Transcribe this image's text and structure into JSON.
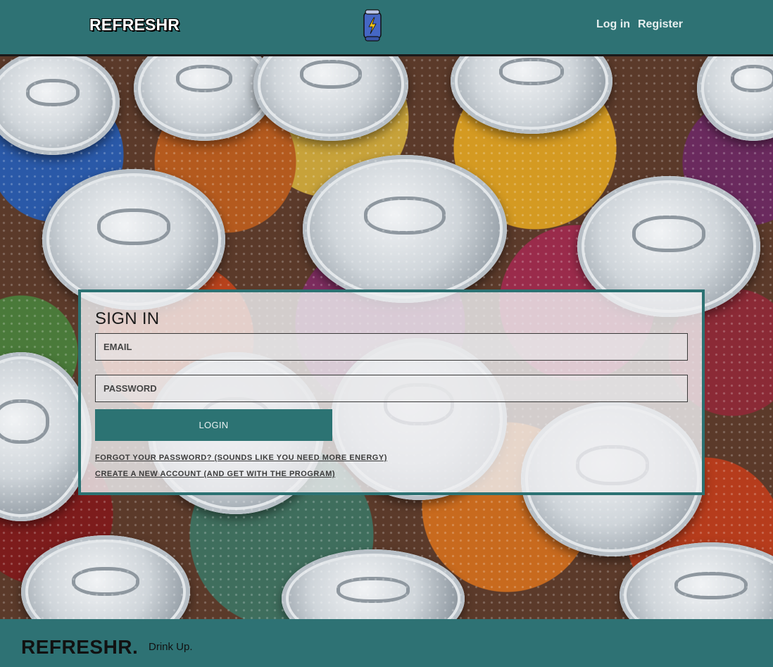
{
  "header": {
    "brand": "REFRESHR",
    "logo_icon": "energy-drink-can-icon",
    "nav": [
      {
        "label": "Log in"
      },
      {
        "label": "Register"
      }
    ]
  },
  "signin": {
    "title": "SIGN IN",
    "email_placeholder": "EMAIL",
    "password_placeholder": "PASSWORD",
    "login_label": "LOGIN",
    "forgot_link": "FORGOT YOUR PASSWORD? (SOUNDS LIKE YOU NEED MORE ENERGY)",
    "create_link": "CREATE A NEW ACCOUNT (AND GET WITH THE PROGRAM)"
  },
  "footer": {
    "brand": "REFRESHR.",
    "tagline": "Drink Up."
  },
  "colors": {
    "accent": "#2e7274",
    "button": "#2c7373"
  }
}
